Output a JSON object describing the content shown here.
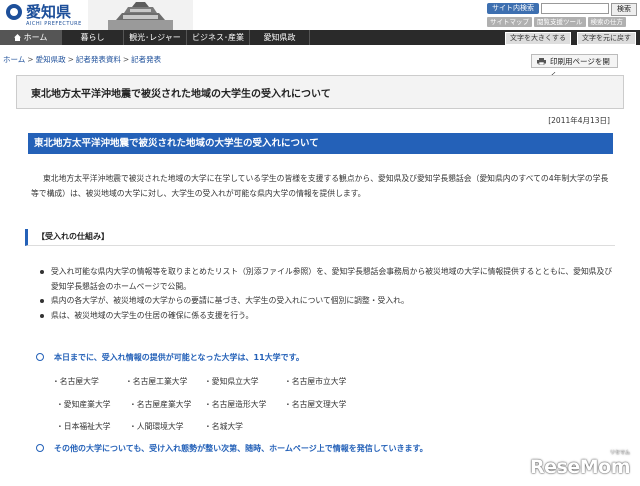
{
  "header": {
    "logo_text": "愛知県",
    "logo_sub": "AICHI PREFECTURE",
    "search_label": "サイト内検索",
    "search_button": "検索",
    "util_links": [
      "サイトマップ",
      "閲覧支援ツール",
      "検索の仕方"
    ]
  },
  "nav": {
    "items": [
      "ホーム",
      "暮らし",
      "観光･レジャー",
      "ビジネス･産業",
      "愛知県政"
    ],
    "text_larger": "文字を大きくする",
    "text_reset": "文字を元に戻す"
  },
  "breadcrumb": [
    "ホーム",
    "愛知県政",
    "記者発表資料",
    "記者発表"
  ],
  "print_button": "印刷用ページを開く",
  "page": {
    "title": "東北地方太平洋沖地震で被災された地域の大学生の受入れについて",
    "date": "[2011年4月13日]",
    "section_title": "東北地方太平洋沖地震で被災された地域の大学生の受入れについて",
    "intro": "東北地方太平洋沖地震で被災された地域の大学に在学している学生の皆様を支援する観点から、愛知県及び愛知学長懇話会（愛知県内のすべての4年制大学の学長等で構成）は、被災地域の大学に対し、大学生の受入れが可能な県内大学の情報を提供します。",
    "subhead": "【受入れの仕組み】",
    "bullets": [
      "受入れ可能な県内大学の情報等を取りまとめたリスト（別添ファイル参照）を、愛知学長懇話会事務局から被災地域の大学に情報提供するとともに、愛知県及び愛知学長懇話会のホームページで公開。",
      "県内の各大学が、被災地域の大学からの要請に基づき、大学生の受入れについて個別に調整・受入れ。",
      "県は、被災地域の大学生の住居の確保に係る支援を行う。"
    ],
    "highlight1": "本日までに、受入れ情報の提供が可能となった大学は、11大学です。",
    "universities": [
      "・名古屋大学",
      "・名古屋工業大学",
      "・愛知県立大学",
      "・名古屋市立大学",
      "・愛知産業大学",
      "・名古屋産業大学",
      "・名古屋造形大学",
      "・名古屋文理大学",
      "・日本福祉大学",
      "・人間環境大学",
      "・名城大学"
    ],
    "highlight2": "その他の大学についても、受け入れ態勢が整い次第、随時、ホームページ上で情報を発信していきます。"
  },
  "watermark": {
    "main": "ReseMom",
    "sub": "リセマム"
  },
  "colors": {
    "accent": "#2461b8",
    "nav_bg": "#2a2a2a",
    "logo": "#1d4f9a"
  }
}
